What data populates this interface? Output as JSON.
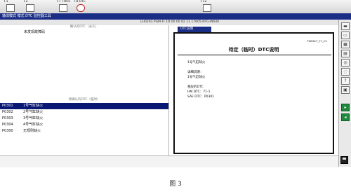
{
  "toolbar": {
    "keys": [
      {
        "label": "F1",
        "icon": "help-book-icon"
      },
      {
        "label": "F2",
        "icon": "checklist-icon"
      },
      {
        "label": "F7 TOOL",
        "icon": "tool-icon"
      },
      {
        "label": "F8 DTC",
        "icon": "dtc-icon"
      },
      {
        "label": "F12",
        "icon": "print-icon"
      }
    ]
  },
  "menubar": {
    "title": "轴成模式 模式 DTC 监控器工具"
  },
  "infobar": {
    "text": "LH0203  PGM-FI  1D 00 00 02 11   17605-RFG-W640"
  },
  "left_panel": {
    "confirmed_header": "确认的DTC（永久）",
    "confirmed_message": "未发现故障码",
    "pending_header": "待确认的DTC（临时）",
    "dtcs": [
      {
        "code": "P0301",
        "desc": "1号气缸缺火",
        "selected": true
      },
      {
        "code": "P0302",
        "desc": "2号气缸缺火",
        "selected": false
      },
      {
        "code": "P0303",
        "desc": "3号气缸缺火",
        "selected": false
      },
      {
        "code": "P0304",
        "desc": "4号气缸缺火",
        "selected": false
      },
      {
        "code": "P0300",
        "desc": "无规则缺火",
        "selected": false
      }
    ]
  },
  "right_panel": {
    "tab_label": "DTC说明",
    "doc_id": "TWRKLF_T1_01",
    "doc_title": "待定（临时）DTC说明",
    "doc_lines": [
      "1号气缸缺火",
      "",
      "详细说明：",
      "1号气缸缺火",
      "",
      "相应的DTC",
      "HM DTC：71-1",
      "SAE DTC：P0301"
    ]
  },
  "sidebar": {
    "buttons": [
      {
        "icon": "folder-icon",
        "glyph": "▬"
      },
      {
        "icon": "folder-open-icon",
        "glyph": "▭"
      },
      {
        "icon": "film-icon",
        "glyph": "▦"
      },
      {
        "icon": "document-icon",
        "glyph": "▤"
      },
      {
        "icon": "zoom-icon",
        "glyph": "◎"
      },
      {
        "icon": "zoom-out-icon",
        "glyph": "◌"
      },
      {
        "icon": "help-icon",
        "glyph": "?"
      },
      {
        "icon": "book-icon",
        "glyph": "▣"
      }
    ],
    "action_buttons": [
      {
        "icon": "next-page-icon",
        "glyph": "▸"
      },
      {
        "icon": "prev-page-icon",
        "glyph": "◂"
      }
    ]
  },
  "caption": "图 3",
  "colors": {
    "title_bar": "#1b2e86",
    "selected_row": "#0a1875",
    "green_button": "#1f8a3f"
  }
}
